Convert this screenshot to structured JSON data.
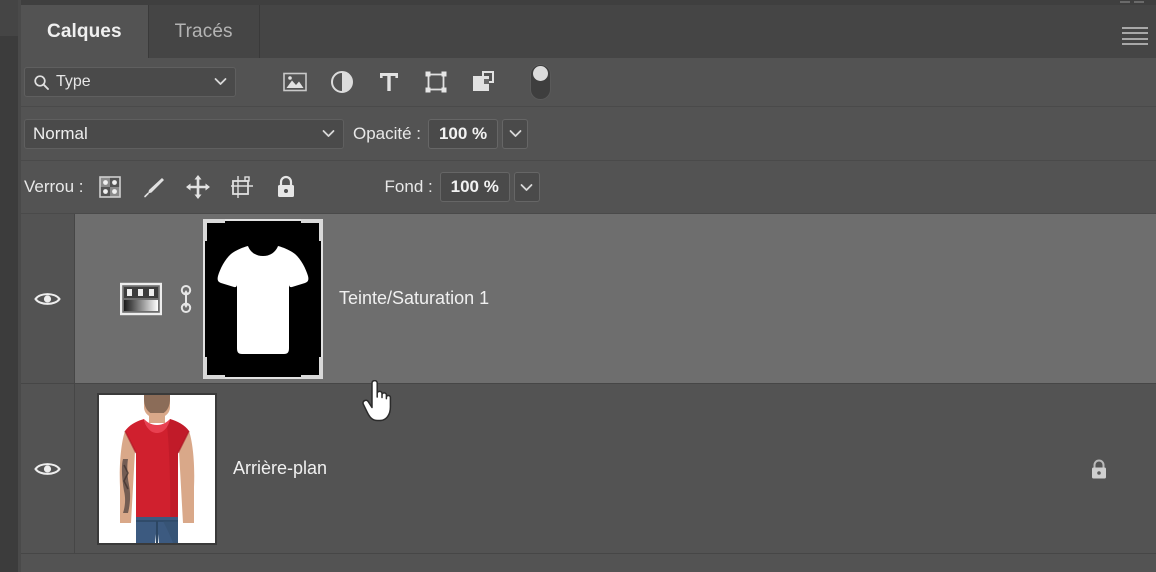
{
  "panel": {
    "tabs": [
      {
        "label": "Calques",
        "active": true
      },
      {
        "label": "Tracés",
        "active": false
      }
    ],
    "menu_icon": "hamburger-menu-icon"
  },
  "filter_row": {
    "search_icon": "search-icon",
    "filter_type_label": "Type",
    "dropdown_icon": "chevron-down-icon",
    "icons": [
      {
        "name": "pixel-layers-filter-icon",
        "title": "Pixels"
      },
      {
        "name": "adjustment-layers-filter-icon",
        "title": "Réglage"
      },
      {
        "name": "type-layers-filter-icon",
        "title": "Texte"
      },
      {
        "name": "shape-layers-filter-icon",
        "title": "Forme"
      },
      {
        "name": "smart-object-filter-icon",
        "title": "Objet dynamique"
      }
    ],
    "toggle": {
      "name": "filter-enable-toggle",
      "state": "on"
    }
  },
  "blend_row": {
    "blend_mode": "Normal",
    "blend_dropdown_icon": "chevron-down-icon",
    "opacity_label": "Opacité :",
    "opacity_value": "100 %",
    "opacity_stepper_icon": "chevron-down-icon"
  },
  "lock_row": {
    "lock_label": "Verrou :",
    "lock_icons": [
      {
        "name": "lock-transparent-pixels-icon"
      },
      {
        "name": "lock-image-pixels-icon"
      },
      {
        "name": "lock-position-icon"
      },
      {
        "name": "lock-artboard-nesting-icon"
      },
      {
        "name": "lock-all-icon"
      }
    ],
    "fill_label": "Fond :",
    "fill_value": "100 %",
    "fill_stepper_icon": "chevron-down-icon"
  },
  "layers": [
    {
      "name": "Teinte/Saturation 1",
      "visible": true,
      "selected": true,
      "visibility_icon": "eye-icon",
      "adjustment_icon": "hue-saturation-adjustment-icon",
      "link_icon": "link-mask-icon",
      "thumb_kind": "layer-mask-thumbnail",
      "mask_selected": true
    },
    {
      "name": "Arrière-plan",
      "visible": true,
      "selected": false,
      "visibility_icon": "eye-icon",
      "thumb_kind": "background-image-thumbnail",
      "locked": true,
      "lock_icon": "lock-icon"
    }
  ],
  "cursor": {
    "type": "pointing-hand-cursor"
  },
  "colors": {
    "panel_bg": "#535353",
    "tabbar_bg": "#454545",
    "selected_row": "#6e6e6e",
    "field_bg": "#4a4a4a",
    "text": "#e8e8e8",
    "shirt_red": "#d0202e",
    "jeans_blue": "#3c5a80"
  }
}
